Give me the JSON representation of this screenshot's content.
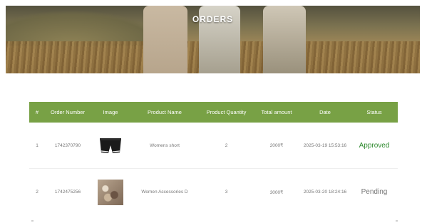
{
  "hero": {
    "title": "ORDERS"
  },
  "table": {
    "headers": [
      "#",
      "Order Number",
      "Image",
      "Product Name",
      "Product Quantity",
      "Total amount",
      "Date",
      "Status"
    ],
    "rows": [
      {
        "index": "1",
        "order_number": "1742370790",
        "image": "shorts-thumbnail",
        "product_name": "Womens short",
        "quantity": "2",
        "total": "2000₹",
        "date": "2025-03-19 15:53:16",
        "status": "Approved",
        "status_color": "#2f8a2f"
      },
      {
        "index": "2",
        "order_number": "1742475256",
        "image": "accessories-thumbnail",
        "product_name": "Women Accessories D",
        "quantity": "3",
        "total": "3000₹",
        "date": "2025-03-20 18:24:16",
        "status": "Pending",
        "status_color": "#777777"
      }
    ]
  },
  "colors": {
    "header_bg": "#78a145",
    "approved": "#2f8a2f"
  }
}
